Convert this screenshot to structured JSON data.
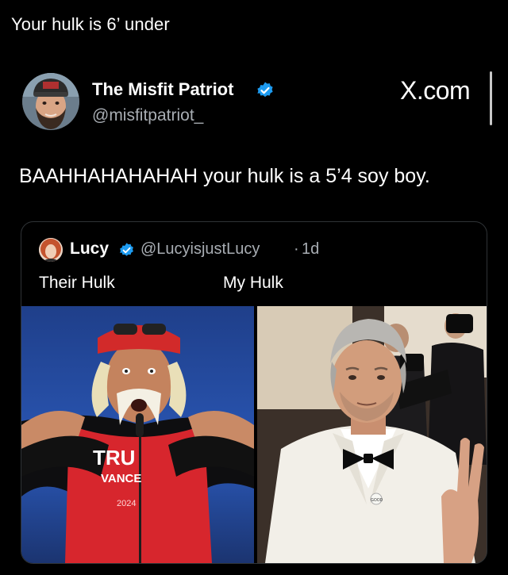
{
  "post": {
    "caption": "Your hulk is 6’ under"
  },
  "tweet": {
    "author_name": "The Misfit Patriot",
    "author_handle": "@misfitpatriot_",
    "brand": "X.com",
    "text": "BAAHHAHAHAHAH your hulk is a 5’4 soy boy.",
    "verified_color": "#1d9bf0"
  },
  "quote": {
    "author_name": "Lucy",
    "author_handle": "@LucyisjustLucy",
    "separator": "·",
    "time": "1d",
    "label_left": "Their Hulk",
    "label_right": "My Hulk",
    "shirt_text_top": "TRU",
    "shirt_text_mid": "VANCE",
    "shirt_text_year": "2024",
    "pin_text": "GOOD"
  },
  "icons": {
    "verified": "verified-check-icon"
  }
}
